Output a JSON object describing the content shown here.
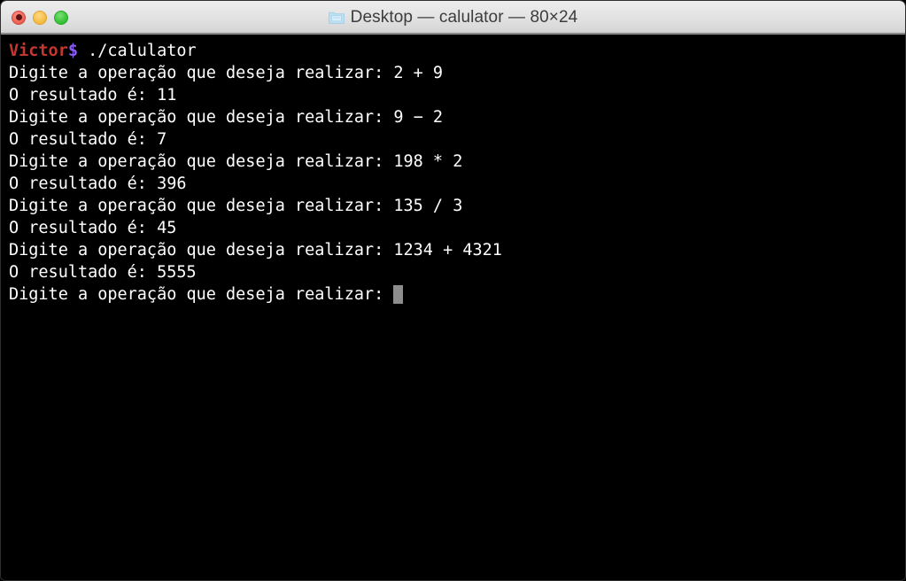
{
  "window": {
    "title": "Desktop — calulator — 80×24",
    "folder_icon": "folder-icon",
    "controls": {
      "close_label": "close",
      "minimize_label": "minimize",
      "maximize_label": "maximize"
    }
  },
  "terminal": {
    "prompt": {
      "user": "Victor",
      "symbol": "$",
      "command": " ./calulator"
    },
    "lines": [
      "Digite a operação que deseja realizar: 2 + 9",
      "O resultado é: 11",
      "Digite a operação que deseja realizar: 9 − 2",
      "O resultado é: 7",
      "Digite a operação que deseja realizar: 198 * 2",
      "O resultado é: 396",
      "Digite a operação que deseja realizar: 135 / 3",
      "O resultado é: 45",
      "Digite a operação que deseja realizar: 1234 + 4321",
      "O resultado é: 5555"
    ],
    "last_prompt": "Digite a operação que deseja realizar: ",
    "colors": {
      "background": "#000000",
      "foreground": "#ffffff",
      "user": "#c4372e",
      "dollar": "#8b5cf6",
      "cursor": "#8d8d8d"
    }
  }
}
